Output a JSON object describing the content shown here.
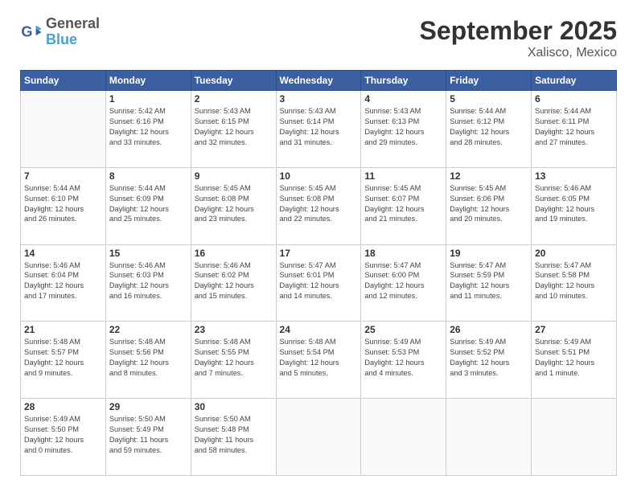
{
  "logo": {
    "line1": "General",
    "line2": "Blue"
  },
  "title": "September 2025",
  "subtitle": "Xalisco, Mexico",
  "headers": [
    "Sunday",
    "Monday",
    "Tuesday",
    "Wednesday",
    "Thursday",
    "Friday",
    "Saturday"
  ],
  "rows": [
    [
      {
        "num": "",
        "info": ""
      },
      {
        "num": "1",
        "info": "Sunrise: 5:42 AM\nSunset: 6:16 PM\nDaylight: 12 hours\nand 33 minutes."
      },
      {
        "num": "2",
        "info": "Sunrise: 5:43 AM\nSunset: 6:15 PM\nDaylight: 12 hours\nand 32 minutes."
      },
      {
        "num": "3",
        "info": "Sunrise: 5:43 AM\nSunset: 6:14 PM\nDaylight: 12 hours\nand 31 minutes."
      },
      {
        "num": "4",
        "info": "Sunrise: 5:43 AM\nSunset: 6:13 PM\nDaylight: 12 hours\nand 29 minutes."
      },
      {
        "num": "5",
        "info": "Sunrise: 5:44 AM\nSunset: 6:12 PM\nDaylight: 12 hours\nand 28 minutes."
      },
      {
        "num": "6",
        "info": "Sunrise: 5:44 AM\nSunset: 6:11 PM\nDaylight: 12 hours\nand 27 minutes."
      }
    ],
    [
      {
        "num": "7",
        "info": "Sunrise: 5:44 AM\nSunset: 6:10 PM\nDaylight: 12 hours\nand 26 minutes."
      },
      {
        "num": "8",
        "info": "Sunrise: 5:44 AM\nSunset: 6:09 PM\nDaylight: 12 hours\nand 25 minutes."
      },
      {
        "num": "9",
        "info": "Sunrise: 5:45 AM\nSunset: 6:08 PM\nDaylight: 12 hours\nand 23 minutes."
      },
      {
        "num": "10",
        "info": "Sunrise: 5:45 AM\nSunset: 6:08 PM\nDaylight: 12 hours\nand 22 minutes."
      },
      {
        "num": "11",
        "info": "Sunrise: 5:45 AM\nSunset: 6:07 PM\nDaylight: 12 hours\nand 21 minutes."
      },
      {
        "num": "12",
        "info": "Sunrise: 5:45 AM\nSunset: 6:06 PM\nDaylight: 12 hours\nand 20 minutes."
      },
      {
        "num": "13",
        "info": "Sunrise: 5:46 AM\nSunset: 6:05 PM\nDaylight: 12 hours\nand 19 minutes."
      }
    ],
    [
      {
        "num": "14",
        "info": "Sunrise: 5:46 AM\nSunset: 6:04 PM\nDaylight: 12 hours\nand 17 minutes."
      },
      {
        "num": "15",
        "info": "Sunrise: 5:46 AM\nSunset: 6:03 PM\nDaylight: 12 hours\nand 16 minutes."
      },
      {
        "num": "16",
        "info": "Sunrise: 5:46 AM\nSunset: 6:02 PM\nDaylight: 12 hours\nand 15 minutes."
      },
      {
        "num": "17",
        "info": "Sunrise: 5:47 AM\nSunset: 6:01 PM\nDaylight: 12 hours\nand 14 minutes."
      },
      {
        "num": "18",
        "info": "Sunrise: 5:47 AM\nSunset: 6:00 PM\nDaylight: 12 hours\nand 12 minutes."
      },
      {
        "num": "19",
        "info": "Sunrise: 5:47 AM\nSunset: 5:59 PM\nDaylight: 12 hours\nand 11 minutes."
      },
      {
        "num": "20",
        "info": "Sunrise: 5:47 AM\nSunset: 5:58 PM\nDaylight: 12 hours\nand 10 minutes."
      }
    ],
    [
      {
        "num": "21",
        "info": "Sunrise: 5:48 AM\nSunset: 5:57 PM\nDaylight: 12 hours\nand 9 minutes."
      },
      {
        "num": "22",
        "info": "Sunrise: 5:48 AM\nSunset: 5:56 PM\nDaylight: 12 hours\nand 8 minutes."
      },
      {
        "num": "23",
        "info": "Sunrise: 5:48 AM\nSunset: 5:55 PM\nDaylight: 12 hours\nand 7 minutes."
      },
      {
        "num": "24",
        "info": "Sunrise: 5:48 AM\nSunset: 5:54 PM\nDaylight: 12 hours\nand 5 minutes."
      },
      {
        "num": "25",
        "info": "Sunrise: 5:49 AM\nSunset: 5:53 PM\nDaylight: 12 hours\nand 4 minutes."
      },
      {
        "num": "26",
        "info": "Sunrise: 5:49 AM\nSunset: 5:52 PM\nDaylight: 12 hours\nand 3 minutes."
      },
      {
        "num": "27",
        "info": "Sunrise: 5:49 AM\nSunset: 5:51 PM\nDaylight: 12 hours\nand 1 minute."
      }
    ],
    [
      {
        "num": "28",
        "info": "Sunrise: 5:49 AM\nSunset: 5:50 PM\nDaylight: 12 hours\nand 0 minutes."
      },
      {
        "num": "29",
        "info": "Sunrise: 5:50 AM\nSunset: 5:49 PM\nDaylight: 11 hours\nand 59 minutes."
      },
      {
        "num": "30",
        "info": "Sunrise: 5:50 AM\nSunset: 5:48 PM\nDaylight: 11 hours\nand 58 minutes."
      },
      {
        "num": "",
        "info": ""
      },
      {
        "num": "",
        "info": ""
      },
      {
        "num": "",
        "info": ""
      },
      {
        "num": "",
        "info": ""
      }
    ]
  ]
}
